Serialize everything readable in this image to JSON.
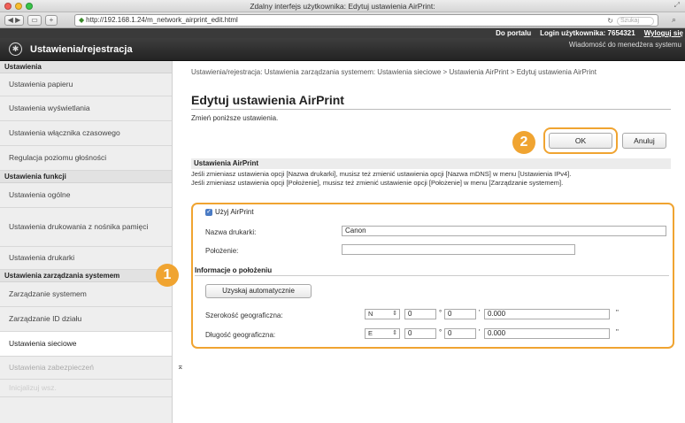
{
  "window": {
    "title": "Zdalny interfejs użytkownika: Edytuj ustawienia AirPrint:",
    "url": "http://192.168.1.24/m_network_airprint_edit.html",
    "search_placeholder": "Szukaj"
  },
  "topbar": {
    "portal_link": "Do portalu",
    "login_label": "Login użytkownika: 7654321",
    "logout_link": "Wyloguj się"
  },
  "appbar": {
    "title": "Ustawienia/rejestracja",
    "message_link": "Wiadomość do menedżera systemu"
  },
  "sidebar": {
    "sections": [
      {
        "title": "Ustawienia",
        "items": [
          "Ustawienia papieru",
          "Ustawienia wyświetlania",
          "Ustawienia włącznika czasowego",
          "Regulacja poziomu głośności"
        ]
      },
      {
        "title": "Ustawienia funkcji",
        "items": [
          "Ustawienia ogólne",
          "Ustawienia drukowania z nośnika pamięci",
          "Ustawienia drukarki"
        ]
      },
      {
        "title": "Ustawienia zarządzania systemem",
        "items": [
          "Zarządzanie systemem",
          "Zarządzanie ID działu",
          "Ustawienia sieciowe",
          "Ustawienia zabezpieczeń",
          "Inicjalizuj wsz."
        ]
      }
    ]
  },
  "main": {
    "breadcrumb": "Ustawienia/rejestracja: Ustawienia zarządzania systemem: Ustawienia sieciowe > Ustawienia AirPrint > Edytuj ustawienia AirPrint",
    "title": "Edytuj ustawienia AirPrint",
    "instruction": "Zmień poniższe ustawienia.",
    "ok_label": "OK",
    "cancel_label": "Anuluj",
    "section_title": "Ustawienia AirPrint",
    "note1": "Jeśli zmieniasz ustawienia opcji [Nazwa drukarki], musisz też zmienić ustawienia opcji [Nazwa mDNS] w menu [Ustawienia IPv4].",
    "note2": "Jeśli zmieniasz ustawienia opcji [Położenie], musisz też zmienić ustawienie opcji [Położenie] w menu [Zarządzanie systemem].",
    "use_airprint_label": "Użyj AirPrint",
    "use_airprint_checked": true,
    "printer_name_label": "Nazwa drukarki:",
    "printer_name_value": "Canon",
    "location_label": "Położenie:",
    "location_value": "",
    "geo_section_title": "Informacje o położeniu",
    "auto_button": "Uzyskaj automatycznie",
    "latitude": {
      "label": "Szerokość geograficzna:",
      "dir": "N",
      "deg": "0",
      "min": "0",
      "sec": "0.000",
      "deg_sign": "°",
      "min_sign": "'",
      "sec_sign": "\""
    },
    "longitude": {
      "label": "Długość geograficzna:",
      "dir": "E",
      "deg": "0",
      "min": "0",
      "sec": "0.000",
      "deg_sign": "°",
      "min_sign": "'",
      "sec_sign": "\""
    },
    "to_top_symbol": "⌅"
  },
  "callouts": {
    "one": "1",
    "two": "2"
  },
  "colors": {
    "callout": "#f0a431",
    "header_dark": "#2f2f2f",
    "checkbox": "#4a7bc4"
  }
}
